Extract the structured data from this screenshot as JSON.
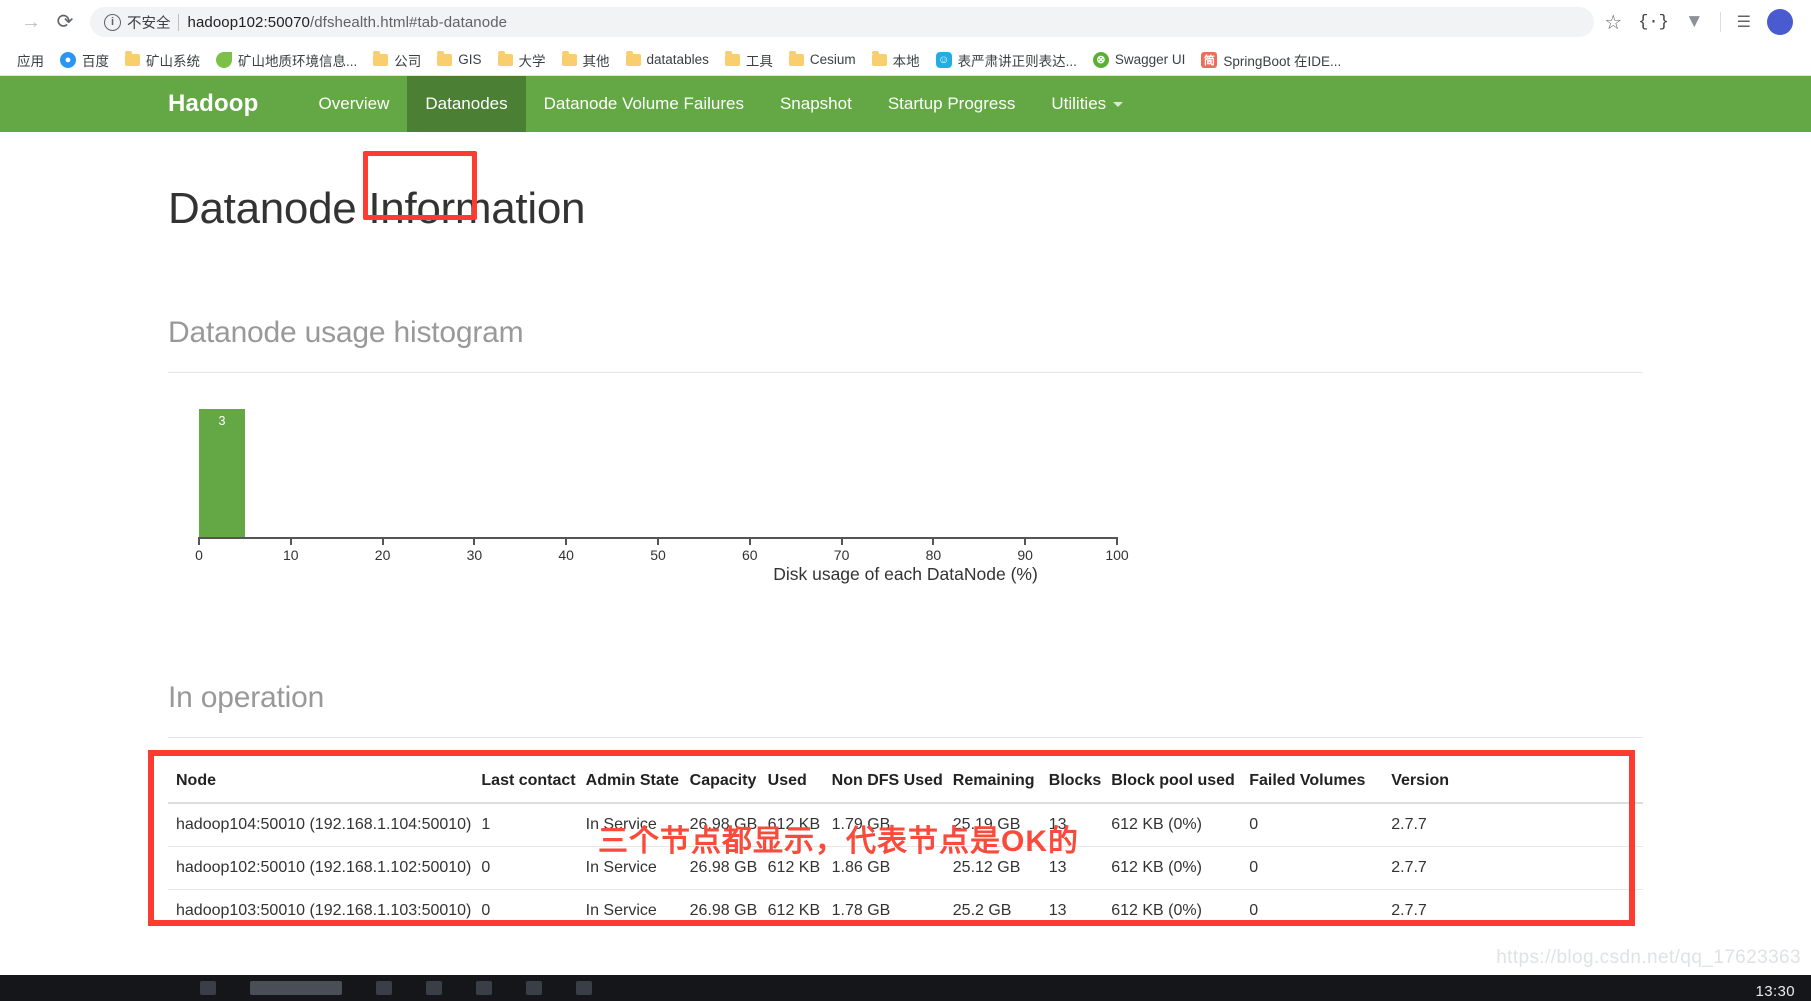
{
  "browser": {
    "back_icon": "back-arrow-icon",
    "forward_label": "→",
    "reload_label": "⟳",
    "security": {
      "icon_label": "ⓘ",
      "text": "不安全"
    },
    "url": {
      "host": "hadoop102:50070",
      "path": "/dfshealth.html#tab-datanode",
      "full": "hadoop102:50070/dfshealth.html#tab-datanode"
    },
    "toolbar_icons": [
      {
        "name": "bookmark-star-icon",
        "glyph": "☆"
      },
      {
        "name": "json-formatter-icon",
        "glyph": "{·}"
      },
      {
        "name": "extension-v-icon",
        "glyph": "▼"
      },
      {
        "name": "reading-list-icon",
        "glyph": "☰"
      }
    ]
  },
  "bookmarks": [
    {
      "label": "应用",
      "icon": "apps-label",
      "kind": "text"
    },
    {
      "label": "百度",
      "icon": "baidu-icon",
      "kind": "baidu"
    },
    {
      "label": "矿山系统",
      "icon": "folder-icon",
      "kind": "folder"
    },
    {
      "label": "矿山地质环境信息...",
      "icon": "leaf-icon",
      "kind": "leaf"
    },
    {
      "label": "公司",
      "icon": "folder-icon",
      "kind": "folder"
    },
    {
      "label": "GIS",
      "icon": "folder-icon",
      "kind": "folder"
    },
    {
      "label": "大学",
      "icon": "folder-icon",
      "kind": "folder"
    },
    {
      "label": "其他",
      "icon": "folder-icon",
      "kind": "folder"
    },
    {
      "label": "datatables",
      "icon": "folder-icon",
      "kind": "folder"
    },
    {
      "label": "工具",
      "icon": "folder-icon",
      "kind": "folder"
    },
    {
      "label": "Cesium",
      "icon": "folder-icon",
      "kind": "folder"
    },
    {
      "label": "本地",
      "icon": "folder-icon",
      "kind": "folder"
    },
    {
      "label": "表严肃讲正则表达...",
      "icon": "bilibili-icon",
      "kind": "tv"
    },
    {
      "label": "Swagger UI",
      "icon": "swagger-icon",
      "kind": "swagger"
    },
    {
      "label": "SpringBoot 在IDE...",
      "icon": "jianshu-icon",
      "kind": "jian"
    }
  ],
  "nav": {
    "brand": "Hadoop",
    "items": [
      {
        "label": "Overview",
        "active": false,
        "caret": false
      },
      {
        "label": "Datanodes",
        "active": true,
        "caret": false
      },
      {
        "label": "Datanode Volume Failures",
        "active": false,
        "caret": false
      },
      {
        "label": "Snapshot",
        "active": false,
        "caret": false
      },
      {
        "label": "Startup Progress",
        "active": false,
        "caret": false
      },
      {
        "label": "Utilities",
        "active": false,
        "caret": true
      }
    ]
  },
  "page": {
    "title": "Datanode Information",
    "histogram_heading": "Datanode usage histogram",
    "in_operation_heading": "In operation",
    "annotation": "三个节点都显示，代表节点是OK的",
    "watermark": "https://blog.csdn.net/qq_17623363"
  },
  "chart_data": {
    "type": "bar",
    "title": "Datanode usage histogram",
    "xlabel": "Disk usage of each DataNode (%)",
    "ylabel": "",
    "categories": [
      "0-5"
    ],
    "values": [
      3
    ],
    "bars": [
      {
        "x_start": 0,
        "x_end": 5,
        "value": 3,
        "label": "3",
        "color": "#63a844"
      }
    ],
    "xlim": [
      0,
      100
    ],
    "ylim": [
      0,
      3
    ],
    "xticks": [
      0,
      10,
      20,
      30,
      40,
      50,
      60,
      70,
      80,
      90,
      100
    ],
    "xticklabels": [
      "0",
      "10",
      "20",
      "30",
      "40",
      "50",
      "60",
      "70",
      "80",
      "90",
      "100"
    ],
    "grid": false,
    "legend": false
  },
  "table": {
    "headers": [
      "Node",
      "Last contact",
      "Admin State",
      "Capacity",
      "Used",
      "Non DFS Used",
      "Remaining",
      "Blocks",
      "Block pool used",
      "Failed Volumes",
      "Version"
    ],
    "rows": [
      {
        "node": "hadoop104:50010 (192.168.1.104:50010)",
        "last_contact": "1",
        "admin_state": "In Service",
        "capacity": "26.98 GB",
        "used": "612 KB",
        "non_dfs_used": "1.79 GB",
        "remaining": "25.19 GB",
        "blocks": "13",
        "block_pool_used": "612 KB (0%)",
        "failed_volumes": "0",
        "version": "2.7.7"
      },
      {
        "node": "hadoop102:50010 (192.168.1.102:50010)",
        "last_contact": "0",
        "admin_state": "In Service",
        "capacity": "26.98 GB",
        "used": "612 KB",
        "non_dfs_used": "1.86 GB",
        "remaining": "25.12 GB",
        "blocks": "13",
        "block_pool_used": "612 KB (0%)",
        "failed_volumes": "0",
        "version": "2.7.7"
      },
      {
        "node": "hadoop103:50010 (192.168.1.103:50010)",
        "last_contact": "0",
        "admin_state": "In Service",
        "capacity": "26.98 GB",
        "used": "612 KB",
        "non_dfs_used": "1.78 GB",
        "remaining": "25.2 GB",
        "blocks": "13",
        "block_pool_used": "612 KB (0%)",
        "failed_volumes": "0",
        "version": "2.7.7"
      }
    ]
  },
  "taskbar": {
    "clock": "13:30"
  },
  "colors": {
    "hadoop_green": "#63a844",
    "active_tab": "#4a7f34",
    "annotation_red": "#fa4a3c",
    "highlight_red": "#fd3b30"
  }
}
